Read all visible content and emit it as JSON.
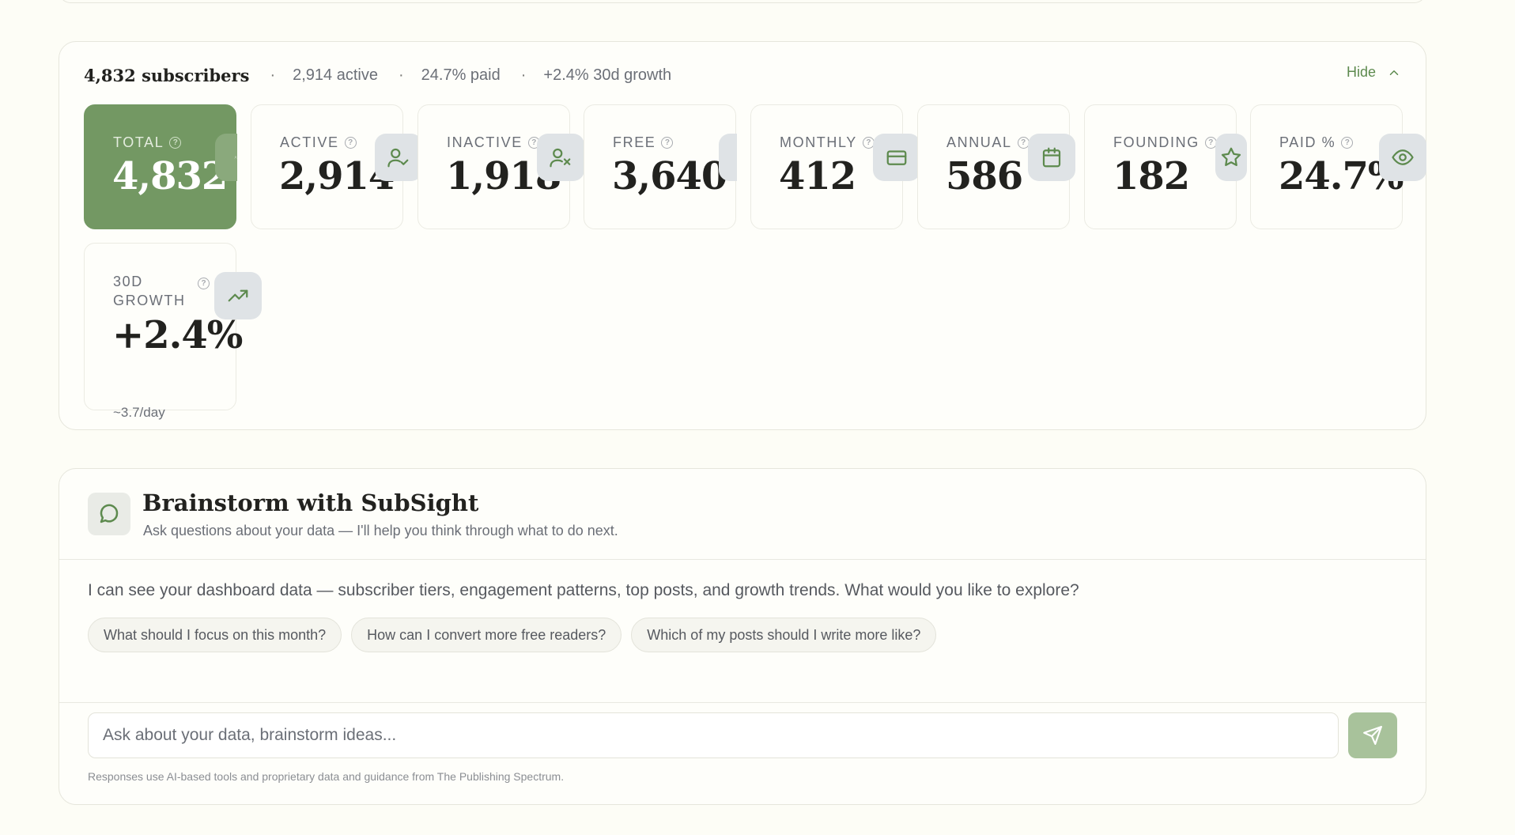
{
  "stats": {
    "subscribers_title": "4,832 subscribers",
    "separator": "·",
    "active_summary": "2,914 active",
    "paid_summary": "24.7% paid",
    "growth_summary": "+2.4% 30d growth",
    "hide_label": "Hide",
    "help_glyph": "?",
    "tiles": [
      {
        "label": "TOTAL",
        "value": "4,832",
        "icon": "user-icon"
      },
      {
        "label": "ACTIVE",
        "value": "2,914",
        "icon": "user-check-icon"
      },
      {
        "label": "INACTIVE",
        "value": "1,918",
        "icon": "user-x-icon"
      },
      {
        "label": "FREE",
        "value": "3,640",
        "icon": "users-icon"
      },
      {
        "label": "MONTHLY",
        "value": "412",
        "icon": "credit-card-icon"
      },
      {
        "label": "ANNUAL",
        "value": "586",
        "icon": "calendar-icon"
      },
      {
        "label": "FOUNDING",
        "value": "182",
        "icon": "star-icon"
      },
      {
        "label": "PAID %",
        "value": "24.7%",
        "icon": "eye-icon"
      },
      {
        "label": "30D GROWTH",
        "value": "+2.4%",
        "sub": "~3.7/day",
        "icon": "trending-up-icon"
      }
    ]
  },
  "brainstorm": {
    "title": "Brainstorm with SubSight",
    "subtitle": "Ask questions about your data — I'll help you think through what to do next.",
    "message": "I can see your dashboard data — subscriber tiers, engagement patterns, top posts, and growth trends. What would you like to explore?",
    "suggestions": [
      "What should I focus on this month?",
      "How can I convert more free readers?",
      "Which of my posts should I write more like?"
    ],
    "input_placeholder": "Ask about your data, brainstorm ideas...",
    "disclaimer": "Responses use AI-based tools and proprietary data and guidance from The Publishing Spectrum."
  },
  "colors": {
    "accent": "#5d8a4e",
    "primary_tile": "#739863",
    "send_button": "#a8c29b",
    "background": "#fdfdf6"
  }
}
